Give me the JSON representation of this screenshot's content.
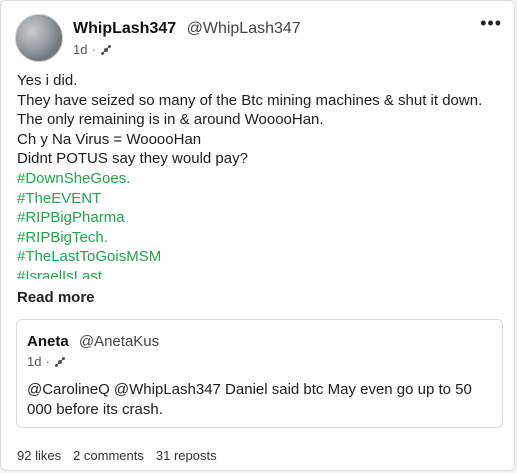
{
  "post": {
    "author_name": "WhipLash347",
    "author_handle": "@WhipLash347",
    "age": "1d",
    "separator": "·",
    "icon": "threads-icon",
    "more_label": "•••",
    "lines": [
      "Yes i did.",
      "They have seized so many of the Btc mining machines & shut it down. The only remaining is in & around WooooHan.",
      "Ch y Na Virus = WooooHan",
      "Didnt POTUS say they would pay?"
    ],
    "hashtags": [
      "#DownSheGoes.",
      "#TheEVENT",
      "#RIPBigPharma",
      "#RIPBigTech.",
      "#TheLastToGoisMSM",
      "#IsraelIsLast"
    ],
    "read_more_label": "Read more"
  },
  "quote": {
    "author_name": "Aneta",
    "author_handle": "@AnetaKus",
    "age": "1d",
    "separator": "·",
    "icon": "threads-icon",
    "text": "@CarolineQ @WhipLash347 Daniel said btc May even go up to 50 000 before its crash."
  },
  "stats": {
    "likes": "92 likes",
    "comments": "2 comments",
    "reposts": "31 reposts"
  },
  "colors": {
    "hashtag": "#1fa64a",
    "background": "#ffffff",
    "border": "#dcdcdc"
  }
}
